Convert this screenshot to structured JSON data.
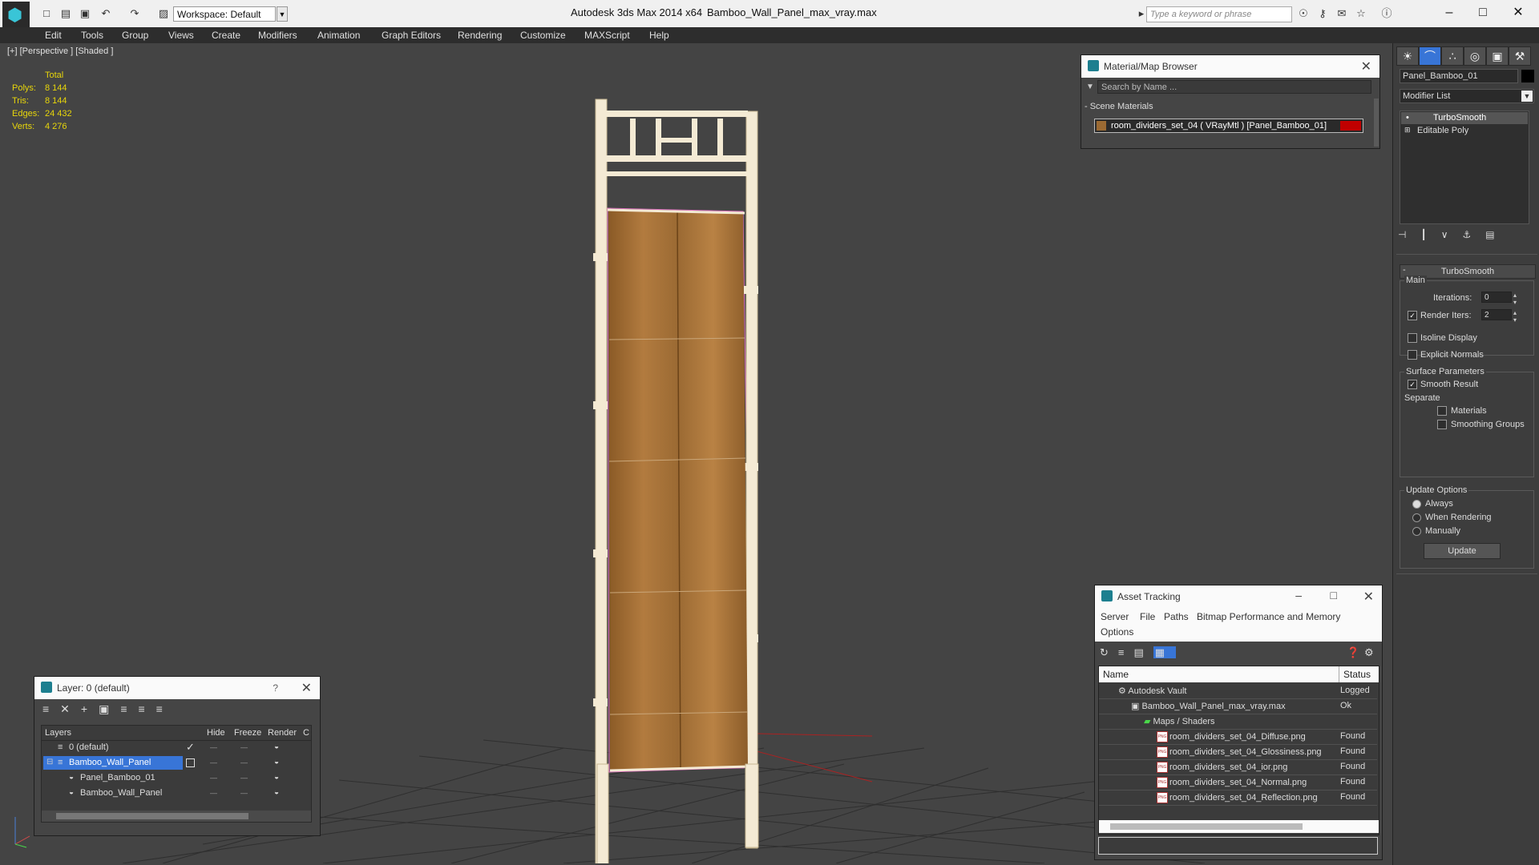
{
  "titlebar": {
    "workspace": "Workspace: Default",
    "app_title": "Autodesk 3ds Max  2014 x64",
    "file_title": "Bamboo_Wall_Panel_max_vray.max",
    "search_placeholder": "Type a keyword or phrase"
  },
  "menu": [
    "Edit",
    "Tools",
    "Group",
    "Views",
    "Create",
    "Modifiers",
    "Animation",
    "Graph Editors",
    "Rendering",
    "Customize",
    "MAXScript",
    "Help"
  ],
  "viewport": {
    "label": "[+] [Perspective ] [Shaded ]",
    "stats": {
      "header": "Total",
      "polys_label": "Polys:",
      "polys": "8 144",
      "tris_label": "Tris:",
      "tris": "8 144",
      "edges_label": "Edges:",
      "edges": "24 432",
      "verts_label": "Verts:",
      "verts": "4 276"
    }
  },
  "material_browser": {
    "title": "Material/Map Browser",
    "search_placeholder": "Search by Name ...",
    "section": "- Scene Materials",
    "material": "room_dividers_set_04  ( VRayMtl )  [Panel_Bamboo_01]"
  },
  "layer_window": {
    "title": "Layer: 0 (default)",
    "help": "?",
    "columns": {
      "layers": "Layers",
      "hide": "Hide",
      "freeze": "Freeze",
      "render": "Render",
      "extra": "C"
    },
    "rows": [
      {
        "name": "0 (default)"
      },
      {
        "name": "Bamboo_Wall_Panel"
      },
      {
        "name": "Panel_Bamboo_01"
      },
      {
        "name": "Bamboo_Wall_Panel"
      }
    ]
  },
  "asset_tracking": {
    "title": "Asset Tracking",
    "menu": {
      "server": "Server",
      "file": "File",
      "paths": "Paths",
      "bitmap": "Bitmap Performance and Memory",
      "options": "Options"
    },
    "columns": {
      "name": "Name",
      "status": "Status"
    },
    "rows": [
      {
        "name": "Autodesk Vault",
        "status": "Logged"
      },
      {
        "name": "Bamboo_Wall_Panel_max_vray.max",
        "status": "Ok"
      },
      {
        "name": "Maps / Shaders",
        "status": ""
      },
      {
        "name": "room_dividers_set_04_Diffuse.png",
        "status": "Found"
      },
      {
        "name": "room_dividers_set_04_Glossiness.png",
        "status": "Found"
      },
      {
        "name": "room_dividers_set_04_ior.png",
        "status": "Found"
      },
      {
        "name": "room_dividers_set_04_Normal.png",
        "status": "Found"
      },
      {
        "name": "room_dividers_set_04_Reflection.png",
        "status": "Found"
      }
    ],
    "png_badge": "PNG"
  },
  "command_panel": {
    "object_name": "Panel_Bamboo_01",
    "modifier_list": "Modifier List",
    "stack": [
      "TurboSmooth",
      "Editable Poly"
    ],
    "rollout_title": "TurboSmooth",
    "main_group": "Main",
    "iterations_label": "Iterations:",
    "iterations_value": "0",
    "render_iters_label": "Render Iters:",
    "render_iters_value": "2",
    "isoline": "Isoline Display",
    "explicit_normals": "Explicit Normals",
    "surface_params": "Surface Parameters",
    "smooth_result": "Smooth Result",
    "separate": "Separate",
    "materials": "Materials",
    "smoothing_groups": "Smoothing Groups",
    "update_options": "Update Options",
    "always": "Always",
    "when_rendering": "When Rendering",
    "manually": "Manually",
    "update_button": "Update"
  },
  "colors": {
    "accent": "#39c5d7",
    "stats": "#e8d60a",
    "material_swatch": "#c00000",
    "selection": "#3875d7"
  }
}
